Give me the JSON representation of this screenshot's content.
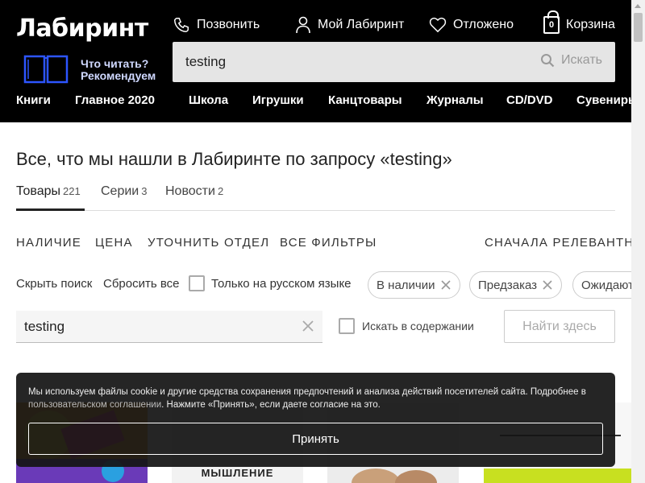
{
  "header": {
    "logo": "Лабиринт",
    "call_label": "Позвонить",
    "account_label": "Мой Лабиринт",
    "saved_label": "Отложено",
    "cart_count": "0",
    "cart_label": "Корзина",
    "recommend_line1": "Что читать?",
    "recommend_line2": "Рекомендуем",
    "search_value": "testing",
    "search_button": "Искать",
    "menu": [
      "Книги",
      "Главное 2020",
      "Школа",
      "Игрушки",
      "Канцтовары",
      "Журналы",
      "CD/DVD",
      "Сувениры"
    ]
  },
  "main": {
    "title": "Все, что мы нашли в Лабиринте по запросу «testing»",
    "tabs": [
      {
        "label": "Товары",
        "count": "221"
      },
      {
        "label": "Серии",
        "count": "3"
      },
      {
        "label": "Новости",
        "count": "2"
      }
    ],
    "filters": [
      "НАЛИЧИЕ",
      "ЦЕНА",
      "УТОЧНИТЬ ОТДЕЛ",
      "ВСЕ ФИЛЬТРЫ"
    ],
    "sort_label": "СНАЧАЛА РЕЛЕВАНТНЫЕ",
    "hide_search": "Скрыть поиск",
    "reset_all": "Сбросить все",
    "russian_only": "Только на русском языке",
    "chips": [
      "В наличии",
      "Предзаказ",
      "Ожидаются"
    ],
    "refine_value": "testing",
    "search_in_contents": "Искать в содержании",
    "find_here": "Найти здесь"
  },
  "cookie": {
    "text_before": "Мы используем файлы cookie и другие средства сохранения предпочтений и анализа действий посетителей сайта. Подробнее в ",
    "link_text": "пользовательском соглашении",
    "text_after": ". Нажмите «Принять», если даете согласие на это.",
    "accept": "Принять"
  },
  "products": {
    "peek_title_2": "МЫШЛЕНИЕ"
  },
  "colors": {
    "header_bg": "#000000",
    "search_bg": "#e5e5e5",
    "cookie_bg": "#141414"
  }
}
